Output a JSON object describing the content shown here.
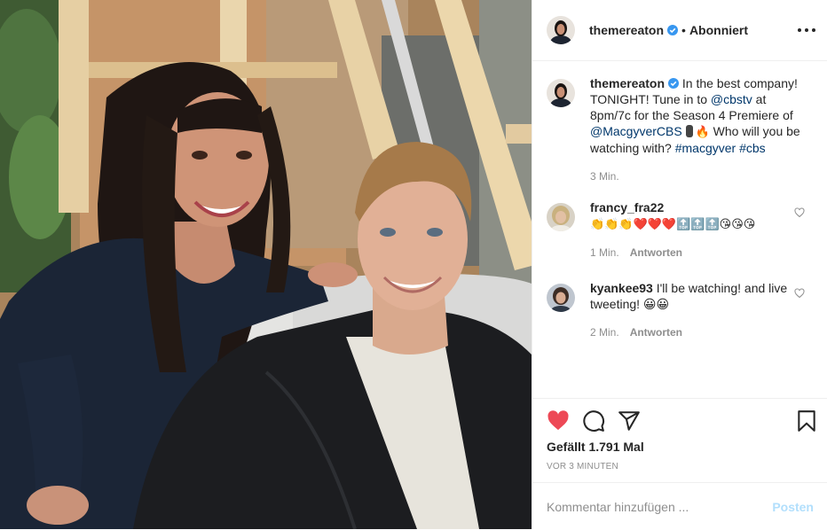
{
  "header": {
    "username": "themereaton",
    "separator": "•",
    "follow_state": "Abonniert",
    "more_icon": "more-horizontal-icon"
  },
  "caption": {
    "username": "themereaton",
    "text_1": "In the best company! TONIGHT! Tune in to ",
    "mention_cbstv": "@cbstv",
    "text_2": " at 8pm/7c for the Season 4 Premiere of ",
    "mention_macgyver": "@MacgyverCBS",
    "emoji_caption": "🔥",
    "text_3": " Who will you be watching with? ",
    "hashtag_macgyver": "#macgyver",
    "hashtag_cbs": "#cbs",
    "time": "3 Min."
  },
  "comments": [
    {
      "username": "francy_fra22",
      "text": "👏👏👏❤️❤️❤️🔝🔝🔝😘😘😘",
      "time": "1 Min.",
      "reply_label": "Antworten"
    },
    {
      "username": "kyankee93",
      "text": "I'll be watching! and live tweeting! 😀😀",
      "time": "2 Min.",
      "reply_label": "Antworten"
    }
  ],
  "actions": {
    "like_icon": "heart-filled-icon",
    "comment_icon": "comment-icon",
    "share_icon": "paper-plane-icon",
    "save_icon": "bookmark-icon",
    "likes_text": "Gefällt 1.791 Mal",
    "posted_ago": "VOR 3 MINUTEN"
  },
  "add_comment": {
    "placeholder": "Kommentar hinzufügen ...",
    "post_label": "Posten"
  },
  "colors": {
    "like_red": "#ed4956",
    "link_blue": "#00376b",
    "verified_blue": "#3897f0",
    "muted": "#8e8e8e",
    "post_disabled": "#b2dffc"
  }
}
